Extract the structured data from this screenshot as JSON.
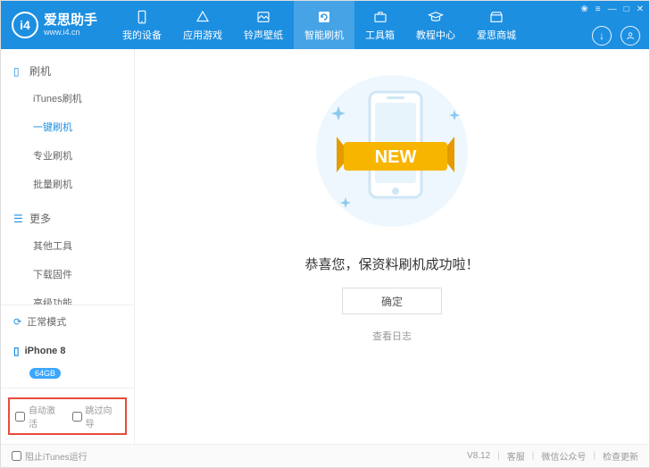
{
  "brand": {
    "name": "爱思助手",
    "url": "www.i4.cn",
    "logo_text": "i4"
  },
  "window_controls": {
    "skin": "❀",
    "menu": "≡",
    "min": "—",
    "max": "□",
    "close": "✕"
  },
  "header": {
    "download_icon": "↓",
    "user_icon": "👤",
    "tabs": [
      {
        "key": "device",
        "label": "我的设备"
      },
      {
        "key": "apps",
        "label": "应用游戏"
      },
      {
        "key": "ring",
        "label": "铃声壁纸"
      },
      {
        "key": "flash",
        "label": "智能刷机"
      },
      {
        "key": "toolbox",
        "label": "工具箱"
      },
      {
        "key": "tutorial",
        "label": "教程中心"
      },
      {
        "key": "mall",
        "label": "爱思商城"
      }
    ],
    "active_key": "flash"
  },
  "sidebar": {
    "section1": {
      "title": "刷机",
      "items": [
        {
          "key": "itunes",
          "label": "iTunes刷机"
        },
        {
          "key": "onekey",
          "label": "一键刷机"
        },
        {
          "key": "pro",
          "label": "专业刷机"
        },
        {
          "key": "batch",
          "label": "批量刷机"
        }
      ],
      "active_key": "onekey"
    },
    "section2": {
      "title": "更多",
      "items": [
        {
          "key": "other",
          "label": "其他工具"
        },
        {
          "key": "fw",
          "label": "下载固件"
        },
        {
          "key": "adv",
          "label": "高级功能"
        }
      ]
    },
    "mode_row": {
      "label": "正常模式"
    },
    "device": {
      "name": "iPhone 8",
      "badge": "64GB"
    },
    "bottom_options": {
      "auto_activate": "自动激活",
      "skip_wizard": "跳过向导"
    }
  },
  "main": {
    "new_text": "NEW",
    "message": "恭喜您，保资料刷机成功啦！",
    "ok_button": "确定",
    "log_link": "查看日志"
  },
  "footer": {
    "block_itunes": "阻止iTunes运行",
    "version": "V8.12",
    "support": "客服",
    "wechat": "微信公众号",
    "update": "检查更新"
  },
  "colors": {
    "primary": "#1d8fe1",
    "accent_orange": "#f7b500"
  }
}
